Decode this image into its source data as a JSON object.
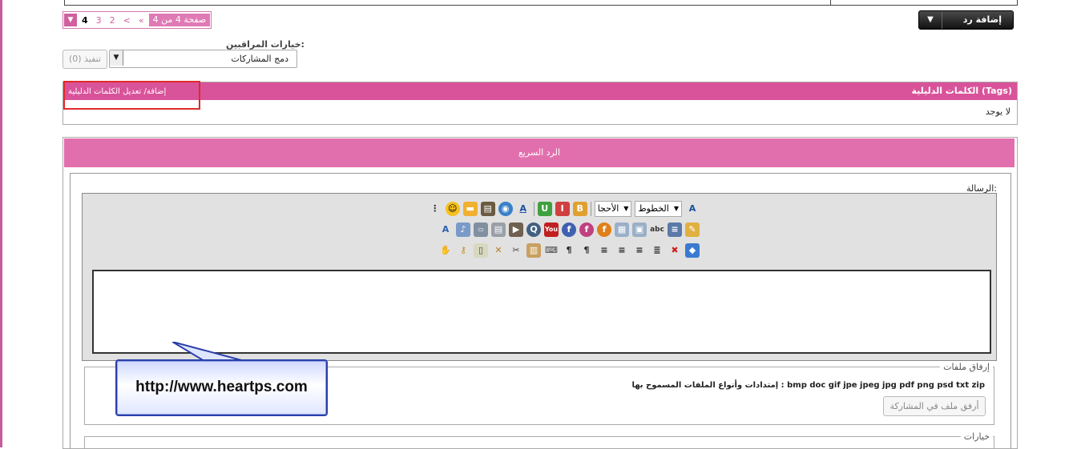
{
  "reply_button": {
    "label": "إضافة رد"
  },
  "pagination": {
    "label": "صفحة 4 من 4",
    "first": "«",
    "prev": "<",
    "pages": [
      "2",
      "3",
      "4"
    ],
    "current": "4"
  },
  "moderator": {
    "title": "خيارات المراقبين:",
    "select_value": "دمج المشاركات",
    "execute_label": "(0) تنفيذ"
  },
  "tags": {
    "title": "الكلمات الدليلية (Tags)",
    "edit_link": "إضافة/ تعديل الكلمات الدليلية",
    "value": "لا يوجد"
  },
  "quick_reply": {
    "title": "الرد السريع",
    "message_label": "الرسالة:",
    "toolbar": {
      "font_select": "الخطوط",
      "size_select": "الأحجا"
    }
  },
  "attachments": {
    "legend": "إرفاق ملفات",
    "types": "إمتدادات وأنواع الملفات المسموح بها : bmp doc gif jpe jpeg jpg pdf png psd txt zip",
    "button": "أرفق ملف في المشاركة"
  },
  "options": {
    "legend": "خيارات"
  },
  "watermark": {
    "url": "http://www.heartps.com"
  },
  "colors": {
    "accent_pink": "#d9539a",
    "header_pink": "#e26fad",
    "highlight_red": "#e02a2a",
    "callout_blue": "#2a3fa8"
  }
}
